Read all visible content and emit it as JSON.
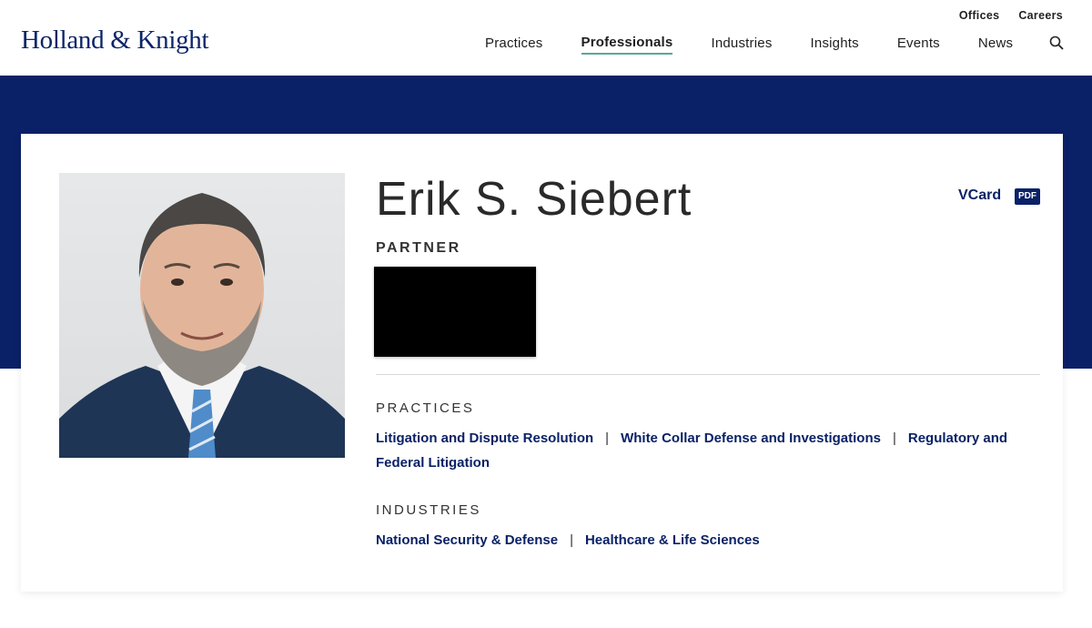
{
  "header": {
    "logo": "Holland & Knight",
    "utility": [
      "Offices",
      "Careers"
    ],
    "nav": [
      {
        "label": "Practices",
        "active": false
      },
      {
        "label": "Professionals",
        "active": true
      },
      {
        "label": "Industries",
        "active": false
      },
      {
        "label": "Insights",
        "active": false
      },
      {
        "label": "Events",
        "active": false
      },
      {
        "label": "News",
        "active": false
      }
    ]
  },
  "profile": {
    "name": "Erik S. Siebert",
    "title": "PARTNER",
    "vcard": "VCard",
    "pdf": "PDF",
    "practices_label": "PRACTICES",
    "practices": [
      "Litigation and Dispute Resolution",
      "White Collar Defense and Investigations",
      "Regulatory and Federal Litigation"
    ],
    "industries_label": "INDUSTRIES",
    "industries": [
      "National Security & Defense",
      "Healthcare & Life Sciences"
    ]
  },
  "colors": {
    "brand_navy": "#0a2167",
    "accent_teal": "#5aa79a"
  }
}
